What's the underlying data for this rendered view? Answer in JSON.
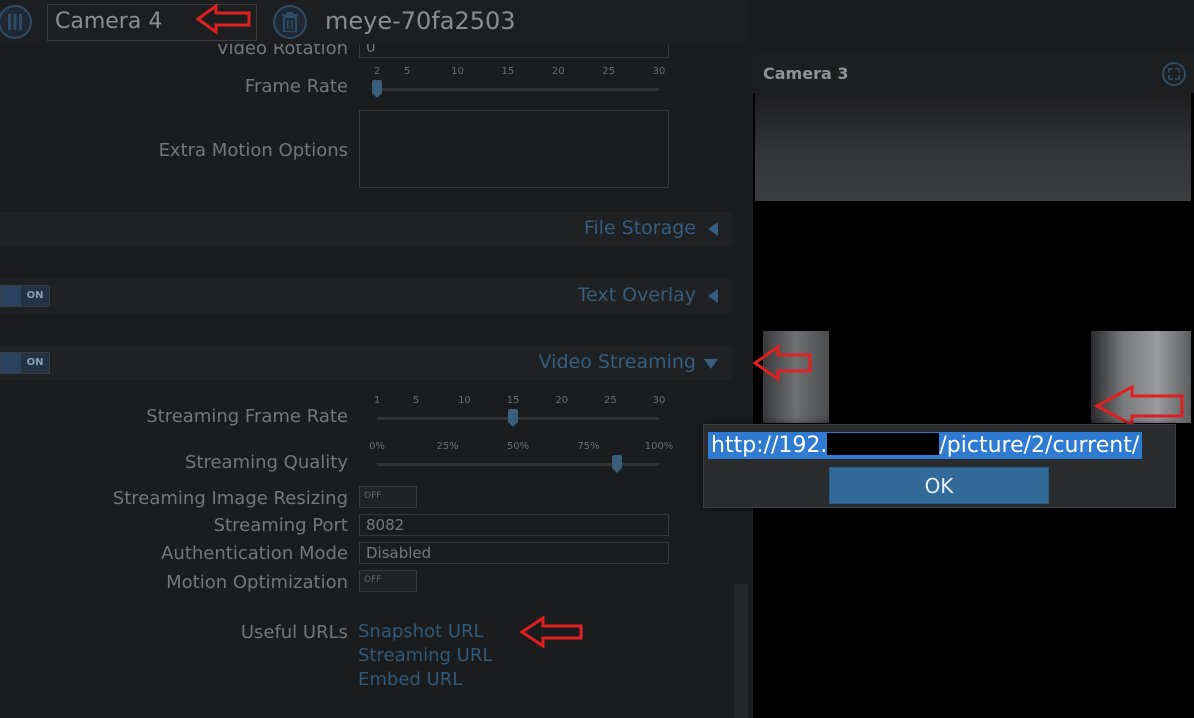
{
  "topbar": {
    "camera_select": "Camera 4",
    "device_name": "meye-70fa2503"
  },
  "settings": {
    "video_rotation_label": "Video Rotation",
    "video_rotation_value": "0",
    "frame_rate_label": "Frame Rate",
    "frame_rate_ticks": [
      "2",
      "5",
      "10",
      "15",
      "20",
      "25",
      "30"
    ],
    "frame_rate_value": 2,
    "extra_motion_label": "Extra Motion Options",
    "sections": {
      "file_storage": "File Storage",
      "text_overlay": "Text Overlay",
      "video_streaming": "Video Streaming"
    },
    "toggle_on_label": "ON",
    "toggle_off_label": "OFF",
    "streaming_frame_rate_label": "Streaming Frame Rate",
    "streaming_frame_rate_ticks": [
      "1",
      "5",
      "10",
      "15",
      "20",
      "25",
      "30"
    ],
    "streaming_frame_rate_value": 15,
    "streaming_quality_label": "Streaming Quality",
    "streaming_quality_ticks": [
      "0%",
      "25%",
      "50%",
      "75%",
      "100%"
    ],
    "streaming_quality_value_percent": 85,
    "streaming_image_resizing_label": "Streaming Image Resizing",
    "streaming_port_label": "Streaming Port",
    "streaming_port_value": "8082",
    "authentication_mode_label": "Authentication Mode",
    "authentication_mode_value": "Disabled",
    "motion_optimization_label": "Motion Optimization",
    "useful_urls_label": "Useful URLs",
    "links": {
      "snapshot": "Snapshot URL",
      "streaming": "Streaming URL",
      "embed": "Embed URL"
    }
  },
  "camera_panel": {
    "title": "Camera 3"
  },
  "dialog": {
    "url_prefix": "http://192.",
    "url_suffix": "/picture/2/current/",
    "ok_label": "OK"
  },
  "colors": {
    "accent": "#355e80",
    "annotation_arrow": "#e02020",
    "selection": "#2f7bd1"
  }
}
